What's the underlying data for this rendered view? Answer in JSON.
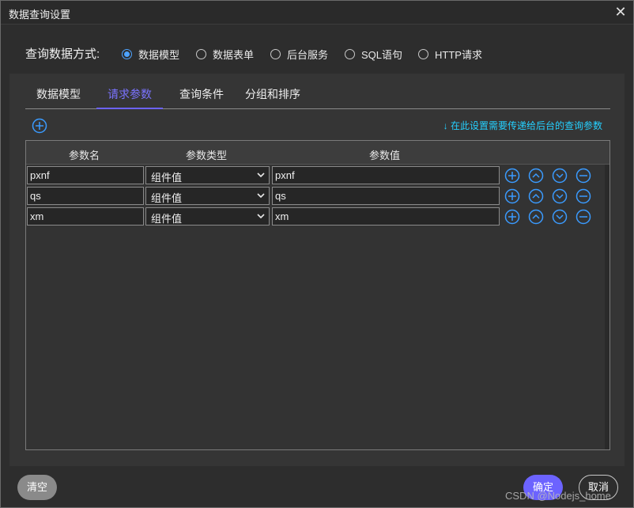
{
  "window": {
    "title": "数据查询设置",
    "close_glyph": "✕"
  },
  "query_mode": {
    "label": "查询数据方式:",
    "options": [
      {
        "label": "数据模型",
        "checked": true
      },
      {
        "label": "数据表单",
        "checked": false
      },
      {
        "label": "后台服务",
        "checked": false
      },
      {
        "label": "SQL语句",
        "checked": false
      },
      {
        "label": "HTTP请求",
        "checked": false
      }
    ]
  },
  "tabs": [
    {
      "label": "数据模型",
      "active": false
    },
    {
      "label": "请求参数",
      "active": true
    },
    {
      "label": "查询条件",
      "active": false
    },
    {
      "label": "分组和排序",
      "active": false
    }
  ],
  "hint": "↓ 在此设置需要传递给后台的查询参数",
  "table": {
    "headers": [
      "参数名",
      "参数类型",
      "参数值"
    ],
    "rows": [
      {
        "name": "pxnf",
        "type": "组件值",
        "value": "pxnf"
      },
      {
        "name": "qs",
        "type": "组件值",
        "value": "qs"
      },
      {
        "name": "xm",
        "type": "组件值",
        "value": "xm"
      }
    ]
  },
  "footer": {
    "clear_label": "清空",
    "ok_label": "确定",
    "cancel_label": "取消"
  },
  "watermark": "CSDN @Nodejs_home",
  "colors": {
    "accent": "#6c63ff",
    "icon_blue": "#3a9bff",
    "hint_cyan": "#25d0ff"
  },
  "icons": [
    "plus-circle-icon",
    "chevron-up-circle-icon",
    "chevron-down-circle-icon",
    "minus-circle-icon",
    "close-icon"
  ]
}
